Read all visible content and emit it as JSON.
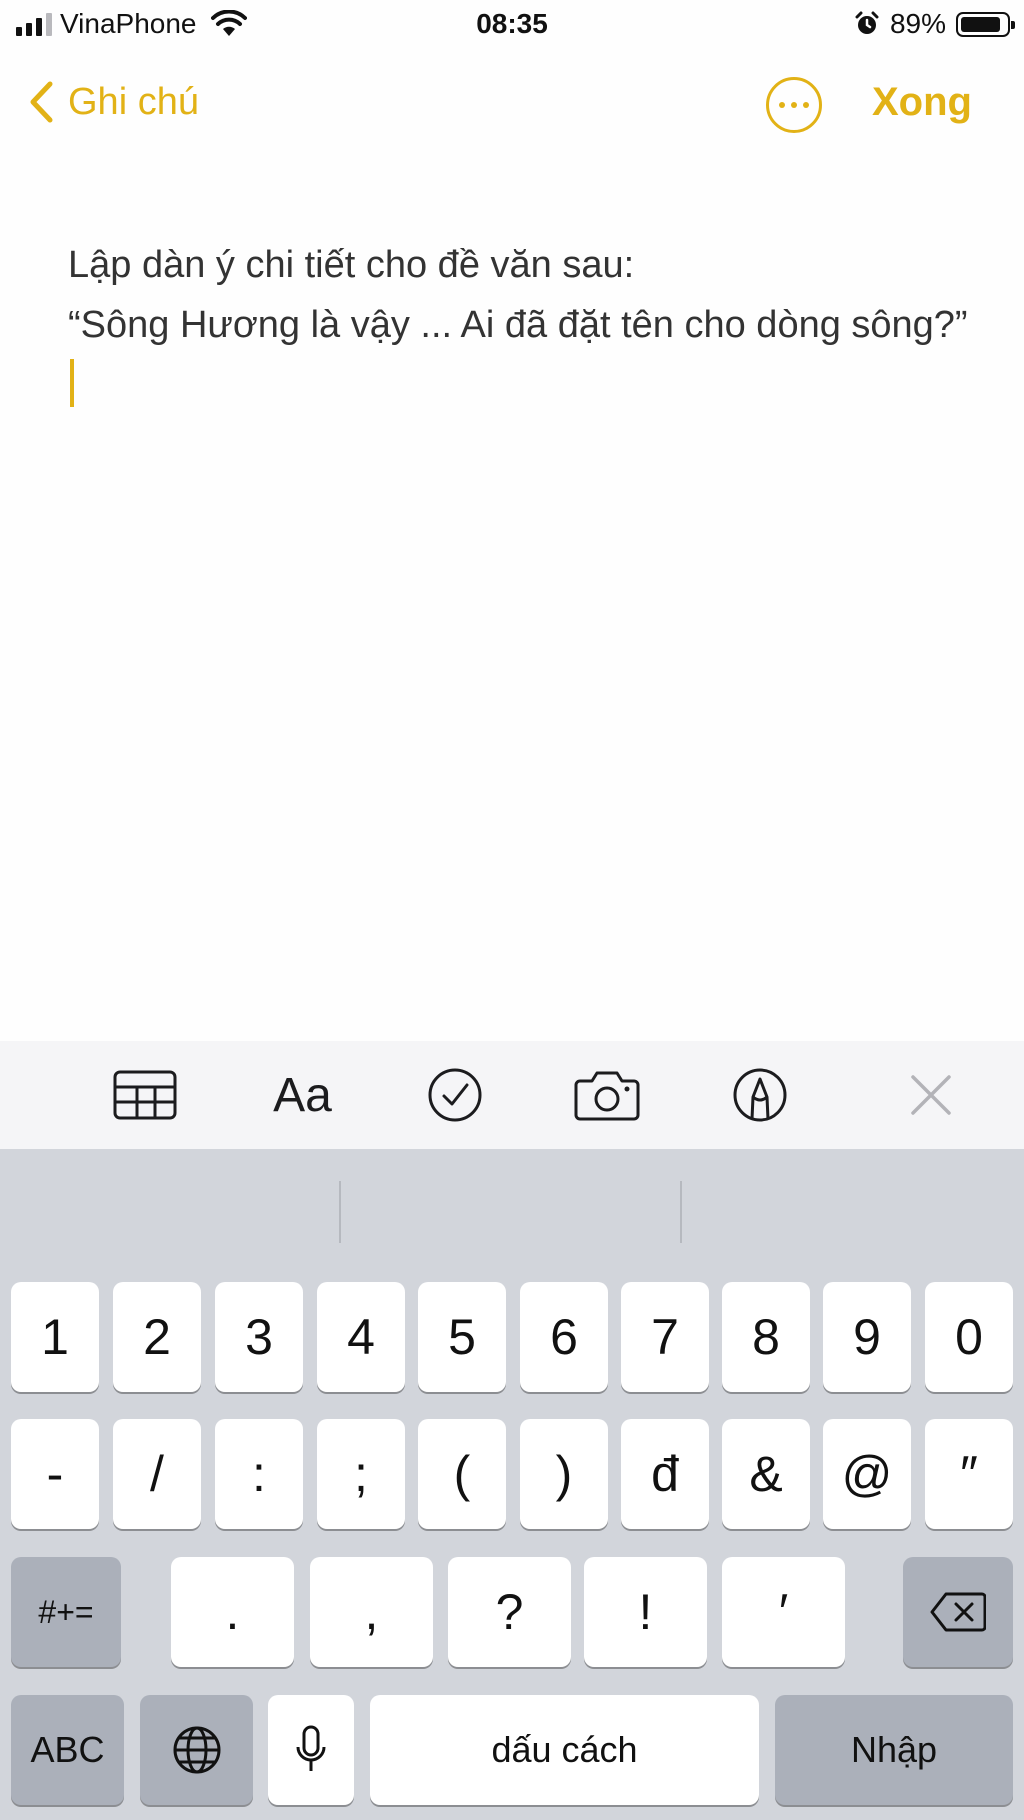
{
  "status_bar": {
    "carrier": "VinaPhone",
    "time": "08:35",
    "battery_percent": "89%",
    "battery_level": 0.89
  },
  "nav": {
    "back_label": "Ghi chú",
    "done_label": "Xong"
  },
  "note": {
    "line1": "Lập dàn ý chi tiết cho đề văn sau:",
    "line2": "“Sông Hương là vậy ... Ai đã đặt tên cho dòng sông?”"
  },
  "toolbar": {
    "items": [
      "table-icon",
      "Aa",
      "checklist-icon",
      "camera-icon",
      "markup-icon",
      "close-icon"
    ],
    "format_label": "Aa"
  },
  "keyboard": {
    "row1": [
      "1",
      "2",
      "3",
      "4",
      "5",
      "6",
      "7",
      "8",
      "9",
      "0"
    ],
    "row2": [
      "-",
      "/",
      ":",
      ";",
      "(",
      ")",
      "đ",
      "&",
      "@",
      "″"
    ],
    "row3_left": "#+=",
    "row3": [
      ".",
      ",",
      "?",
      "!",
      "′"
    ],
    "abc_label": "ABC",
    "space_label": "dấu cách",
    "return_label": "Nhập"
  },
  "colors": {
    "accent": "#e2b216",
    "keyboard_bg": "#d2d5db",
    "dark_key": "#abb0ba"
  }
}
